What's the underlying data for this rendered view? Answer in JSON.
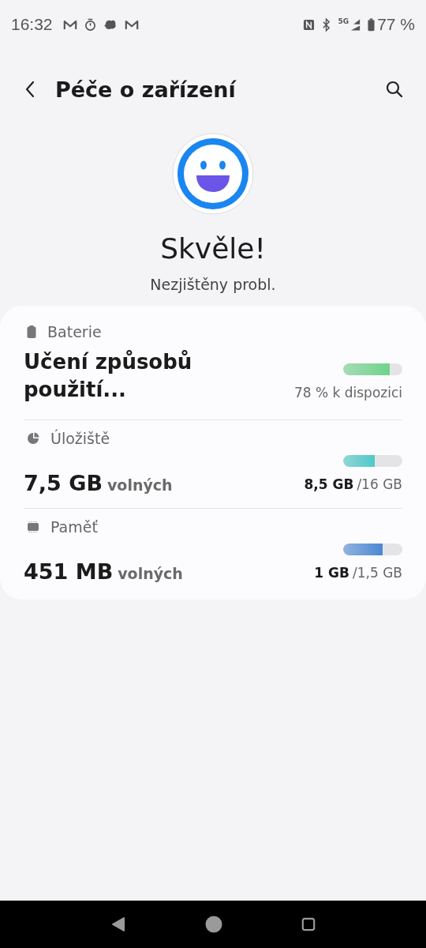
{
  "status_bar": {
    "time": "16:32",
    "network": "5G",
    "battery": "77 %"
  },
  "header": {
    "title": "Péče o zařízení"
  },
  "summary": {
    "title": "Skvěle!",
    "subtitle": "Nezjištěny probl."
  },
  "items": [
    {
      "kind": "status",
      "label": "Baterie",
      "value": "Učení způsobů použití...",
      "level": 0.78,
      "color": "#6fd38a",
      "reading": "78 % k dispozici"
    },
    {
      "kind": "usage",
      "label": "Úložiště",
      "value": "7,5 GB",
      "unit": "volných",
      "level": 0.53,
      "color": "#4cc9c9",
      "used": "8,5 GB",
      "total": "/16 GB"
    },
    {
      "kind": "usage",
      "label": "Paměť",
      "value": "451 MB",
      "unit": "volných",
      "level": 0.67,
      "color": "#4a87d6",
      "used": "1 GB",
      "total": "/1,5 GB"
    }
  ]
}
